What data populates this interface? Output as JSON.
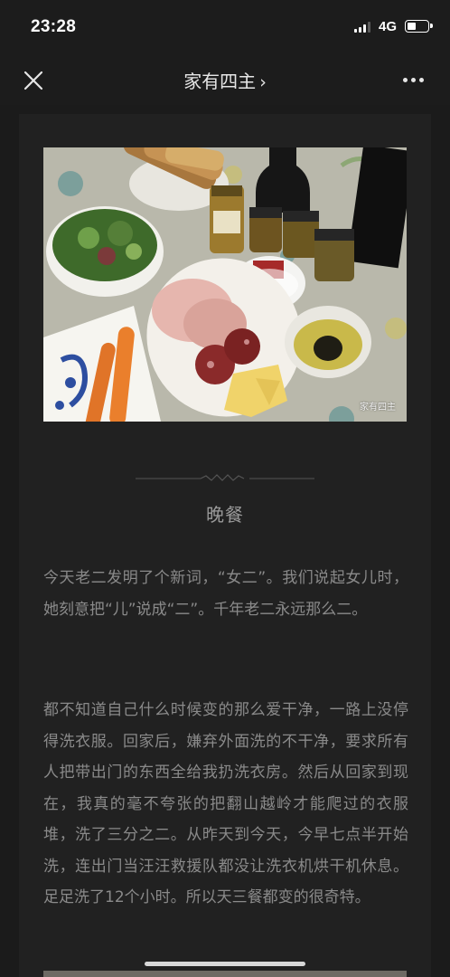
{
  "status_bar": {
    "time": "23:28",
    "network": "4G"
  },
  "nav": {
    "close_icon": "close-icon",
    "title": "家有四主",
    "chevron": "›",
    "more_icon": "more-dots-icon"
  },
  "article": {
    "image_watermark": "家有四主",
    "section_title": "晚餐",
    "paragraphs": [
      "今天老二发明了个新词，“女二”。我们说起女儿时，她刻意把“儿”说成“二”。千年老二永远那么二。",
      "都不知道自己什么时候变的那么爱干净，一路上没停得洗衣服。回家后，嫌弃外面洗的不干净，要求所有人把带出门的东西全给我扔洗衣房。然后从回家到现在，我真的毫不夸张的把翻山越岭才能爬过的衣服堆，洗了三分之二。从昨天到今天，今早七点半开始洗，连出门当汪汪救援队都没让洗衣机烘干机休息。足足洗了12个小时。所以天三餐都变的很奇特。"
    ]
  },
  "colors": {
    "background": "#1b1b1b",
    "card": "#212121",
    "text": "#8a8a8a",
    "nav_text": "#e6e6e6"
  }
}
